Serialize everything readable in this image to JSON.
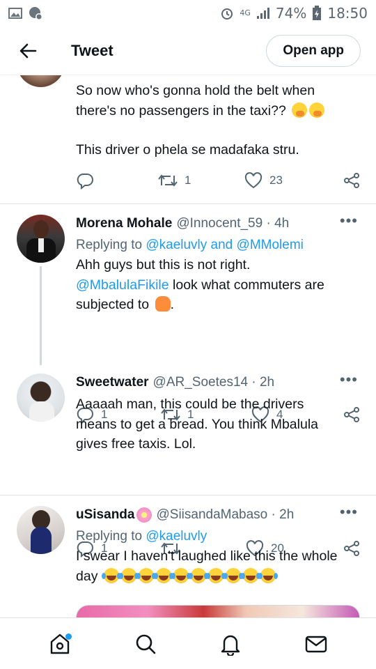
{
  "status_bar": {
    "network": "4G",
    "battery": "74%",
    "time": "18:50"
  },
  "header": {
    "title": "Tweet",
    "open_app_label": "Open app"
  },
  "tweets": [
    {
      "text_line1": "So now who's gonna hold the belt when",
      "text_line2": "there's no passengers in the taxi??",
      "text_line3": "This driver o phela se madafaka stru.",
      "reply_count": "",
      "retweet_count": "1",
      "like_count": "23"
    },
    {
      "name": "Morena Mohale",
      "handle": "@Innocent_59 · 4h",
      "replying_prefix": "Replying to",
      "replying_to": "@kaeluvly and @MMolemi",
      "text_line1": "Ahh guys but this is not right.",
      "text_mention": "@MbalulaFikile",
      "text_line2_rest": " look what commuters are",
      "text_line3": "subjected to",
      "text_line3_end": ".",
      "reply_count": "1",
      "retweet_count": "1",
      "like_count": "4"
    },
    {
      "name": "Sweetwater",
      "handle": "@AR_Soetes14 · 2h",
      "text_line1": "Aaaaah man, this could be the drivers",
      "text_line2": "means to get a bread. You think Mbalula",
      "text_line3": "gives free taxis. Lol.",
      "reply_count": "1",
      "retweet_count": "",
      "like_count": "20"
    },
    {
      "name": "uSisanda",
      "handle": "@SiisandaMabaso · 2h",
      "replying_prefix": "Replying to",
      "replying_to": "@kaeluvly",
      "text_line1": "I swear I haven't laughed like this the whole",
      "text_line2": "day"
    }
  ],
  "colors": {
    "accent": "#1d9bf0",
    "secondary_text": "#536471",
    "primary_text": "#0f1419"
  },
  "icons": [
    "back-arrow-icon",
    "reply-icon",
    "retweet-icon",
    "like-icon",
    "share-icon",
    "more-icon",
    "home-icon",
    "search-icon",
    "notifications-icon",
    "messages-icon"
  ]
}
